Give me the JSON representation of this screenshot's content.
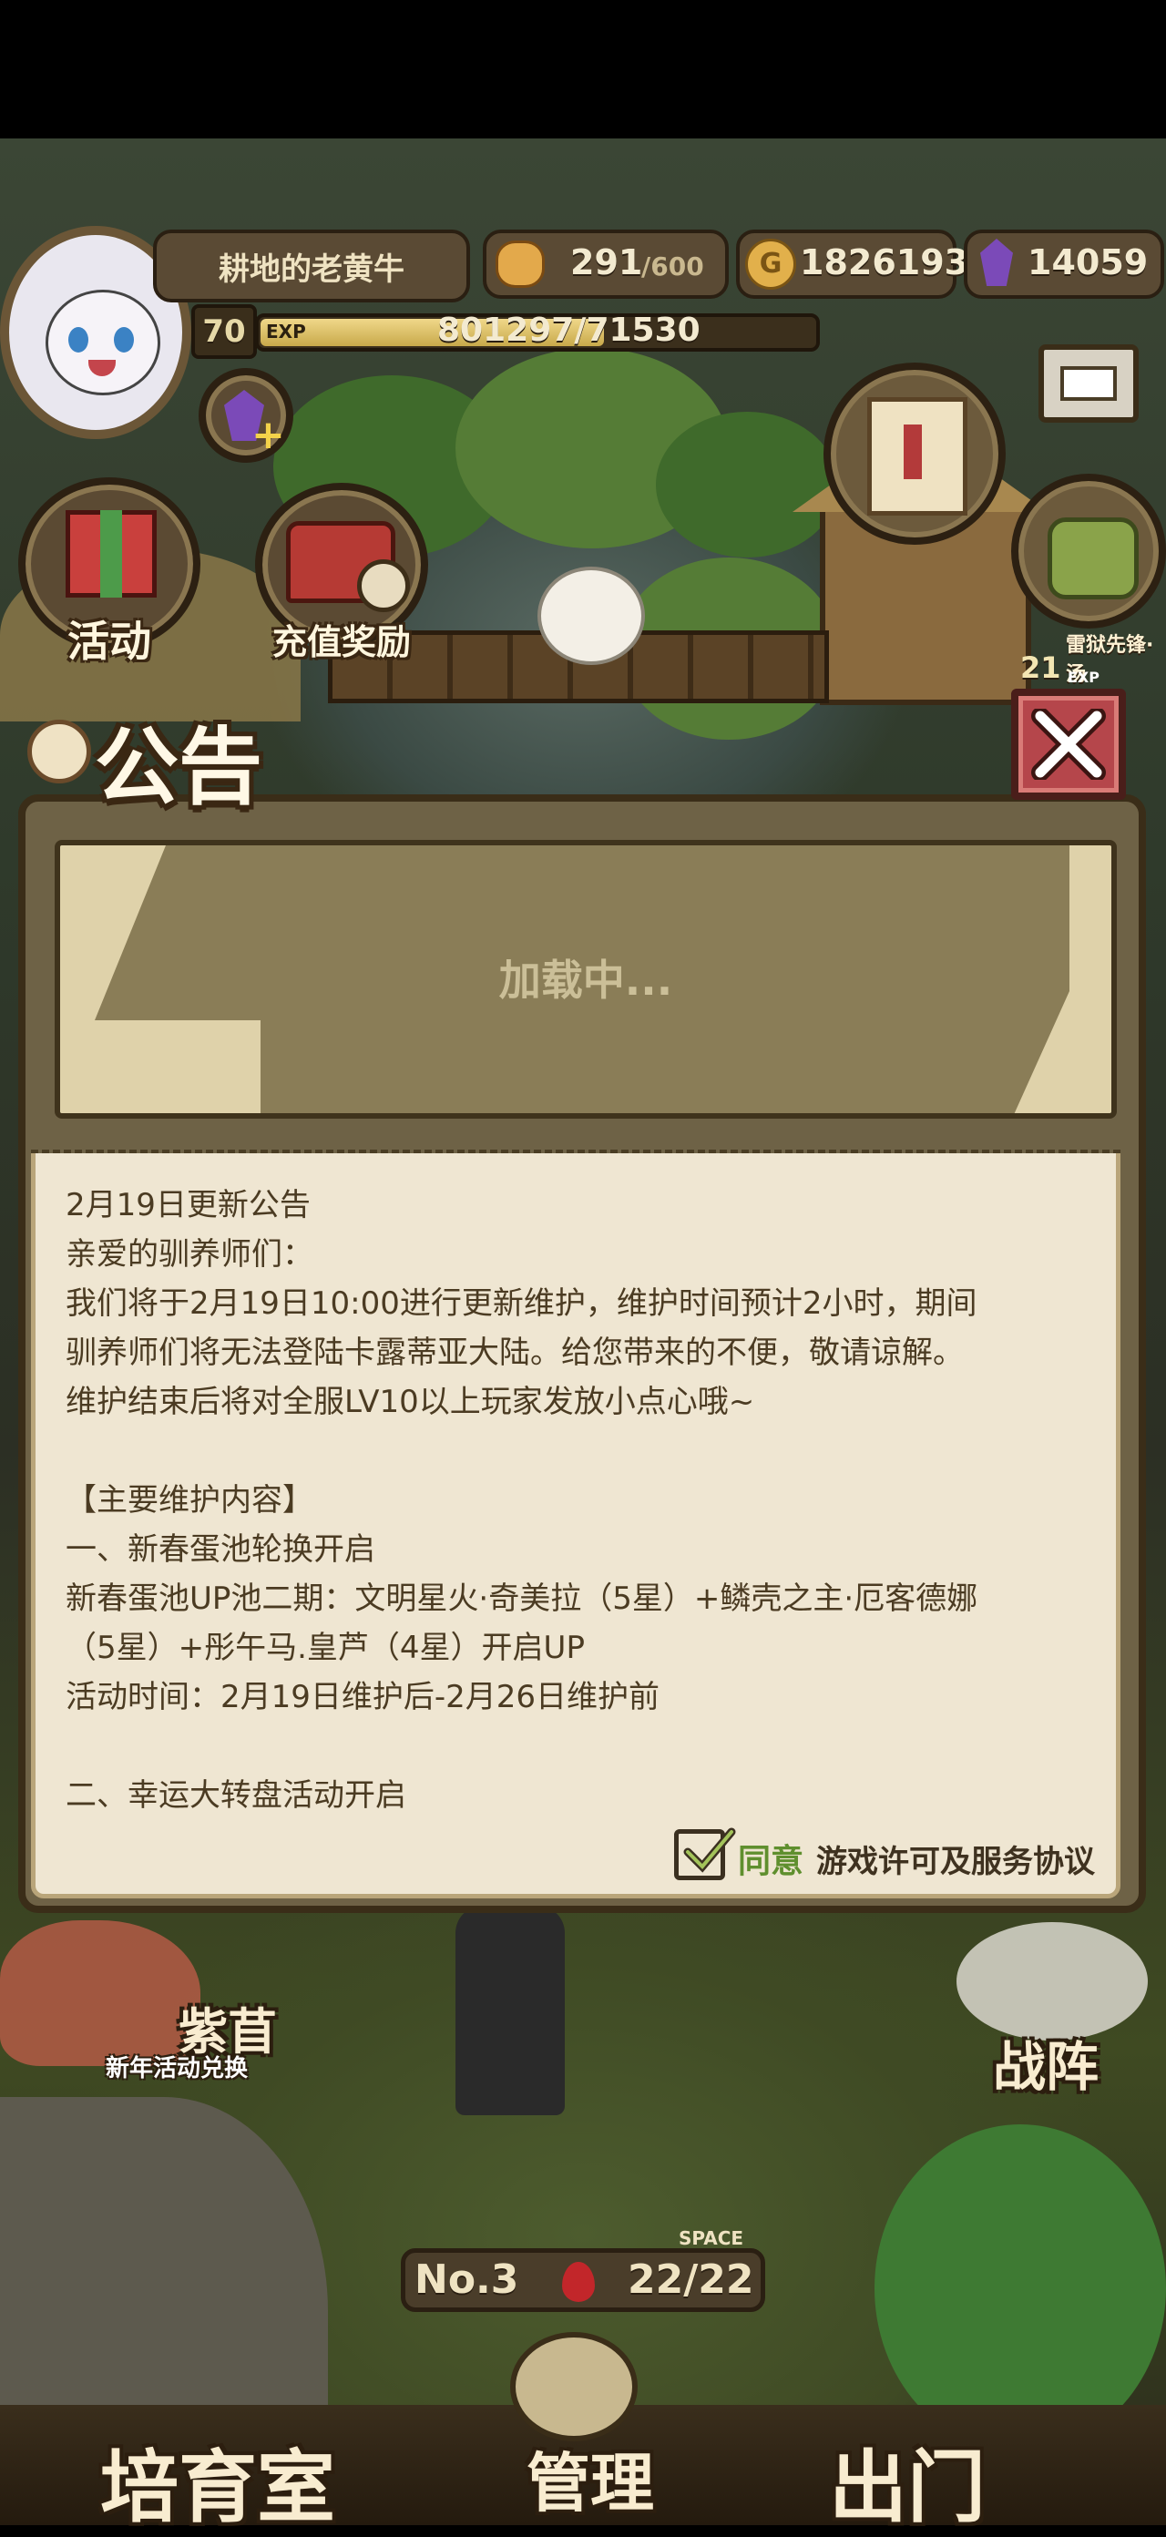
{
  "player": {
    "name": "耕地的老黄牛",
    "level": "70",
    "exp_label": "EXP",
    "exp_value": "801297/71530",
    "exp_fraction": 0.62
  },
  "resources": {
    "stamina_current": "291",
    "stamina_max": "/600",
    "gold": "1826193",
    "gems": "14059"
  },
  "side_buttons": {
    "activity": "活动",
    "recharge_reward": "充值奖励",
    "right_label": "雷狱先锋·汤",
    "right_level": "21",
    "right_exp": "EXP"
  },
  "dialog": {
    "title": "公告",
    "loading": "加载中...",
    "content_lines": [
      "2月19日更新公告",
      "亲爱的驯养师们：",
      "我们将于2月19日10:00进行更新维护，维护时间预计2小时，期间",
      "驯养师们将无法登陆卡露蒂亚大陆。给您带来的不便，敬请谅解。",
      "维护结束后将对全服LV10以上玩家发放小点心哦~",
      "",
      "【主要维护内容】",
      "一、新春蛋池轮换开启",
      "新春蛋池UP池二期：文明星火·奇美拉（5星）+鳞壳之主·厄客德娜",
      "（5星）+彤午马.皇芦（4星）开启UP",
      "活动时间：2月19日维护后-2月26日维护前",
      "",
      "二、幸运大转盘活动开启"
    ],
    "agree_label": "同意",
    "agreement_link": "游戏许可及服务协议",
    "agreed": true
  },
  "bottom": {
    "event_name": "紫苜",
    "event_sub": "新年活动兑换",
    "formation": "战阵",
    "room_no": "No.3",
    "space_label": "SPACE",
    "space_value": "22/22",
    "nursery": "培育室",
    "manage": "管理",
    "go_out": "出门"
  }
}
